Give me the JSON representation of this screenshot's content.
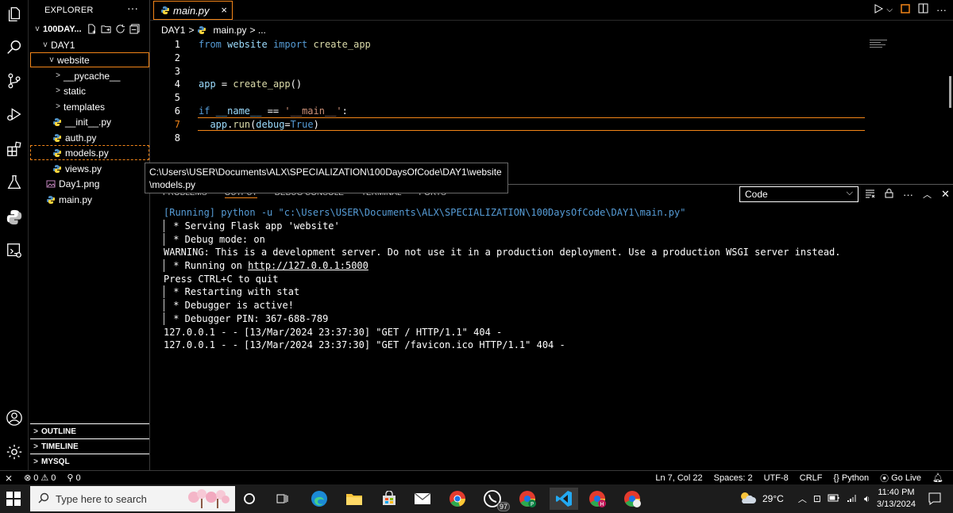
{
  "sidebar": {
    "title": "EXPLORER",
    "more": "···",
    "workspace": "100DAY...",
    "tree": [
      {
        "label": "DAY1",
        "chevron": "v"
      },
      {
        "label": "website",
        "chevron": "v"
      },
      {
        "label": "__pycache__",
        "chevron": ">"
      },
      {
        "label": "static",
        "chevron": ">"
      },
      {
        "label": "templates",
        "chevron": ">"
      },
      {
        "label": "__init__.py"
      },
      {
        "label": "auth.py"
      },
      {
        "label": "models.py"
      },
      {
        "label": "views.py"
      },
      {
        "label": "Day1.png"
      },
      {
        "label": "main.py"
      }
    ],
    "sections": [
      "OUTLINE",
      "TIMELINE",
      "MYSQL"
    ]
  },
  "tab": {
    "label": "main.py",
    "close": "×"
  },
  "breadcrumb": {
    "folder": "DAY1",
    "sep": ">",
    "file": "main.py",
    "tail": "> ..."
  },
  "code": {
    "line_numbers": [
      "1",
      "2",
      "3",
      "4",
      "5",
      "6",
      "7",
      "8"
    ],
    "line1": {
      "kw1": "from",
      "mod": " website ",
      "kw2": "import",
      "rest": " create_app"
    },
    "line4": {
      "var": "app",
      "op": " = ",
      "fn": "create_app",
      "paren": "()"
    },
    "line6": {
      "kw": "if",
      "name": " __name__",
      "op": " == ",
      "str": "'__main__'",
      "colon": ":"
    },
    "line7": {
      "pre": "  ",
      "obj": "app",
      "dot": ".",
      "fn": "run",
      "open": "(",
      "param": "debug",
      "eq": "=",
      "val": "True",
      "close": ")"
    }
  },
  "tooltip": {
    "text": "C:\\Users\\USER\\Documents\\ALX\\SPECIALIZATION\\100DaysOfCode\\DAY1\\website\\models.py"
  },
  "panel": {
    "tabs": [
      "PROBLEMS",
      "OUTPUT",
      "DEBUG CONSOLE",
      "TERMINAL",
      "PORTS"
    ],
    "select_value": "Code",
    "running_tag": "[Running]",
    "running_cmd": " python -u \"c:\\Users\\USER\\Documents\\ALX\\SPECIALIZATION\\100DaysOfCode\\DAY1\\main.py\"",
    "out1": " * Serving Flask app 'website'",
    "out2": " * Debug mode: on",
    "out3": "WARNING: This is a development server. Do not use it in a production deployment. Use a production WSGI server instead.",
    "out4_pre": " * Running on ",
    "out4_link": "http://127.0.0.1:5000",
    "out5": "Press CTRL+C to quit",
    "out6": " * Restarting with stat",
    "out7": " * Debugger is active!",
    "out8": " * Debugger PIN: 367-688-789",
    "out9": "127.0.0.1 - - [13/Mar/2024 23:37:30] \"GET / HTTP/1.1\" 404 -",
    "out10": "127.0.0.1 - - [13/Mar/2024 23:37:30] \"GET /favicon.ico HTTP/1.1\" 404 -"
  },
  "status": {
    "errors": "0",
    "warnings": "0",
    "ports": "0",
    "position": "Ln 7, Col 22",
    "spaces": "Spaces: 2",
    "encoding": "UTF-8",
    "eol": "CRLF",
    "language": "Python",
    "golive": "Go Live"
  },
  "taskbar": {
    "search_placeholder": "Type here to search",
    "whatsapp_badge": "97",
    "weather": "29°C",
    "time": "11:40 PM",
    "date": "3/13/2024"
  },
  "colors": {
    "accent": "#f38518",
    "keyword": "#569cd6",
    "string": "#ce9178",
    "function": "#dcdcaa",
    "variable": "#9cdcfe",
    "python_blue": "#3572A5",
    "python_yellow": "#FFD43B"
  }
}
